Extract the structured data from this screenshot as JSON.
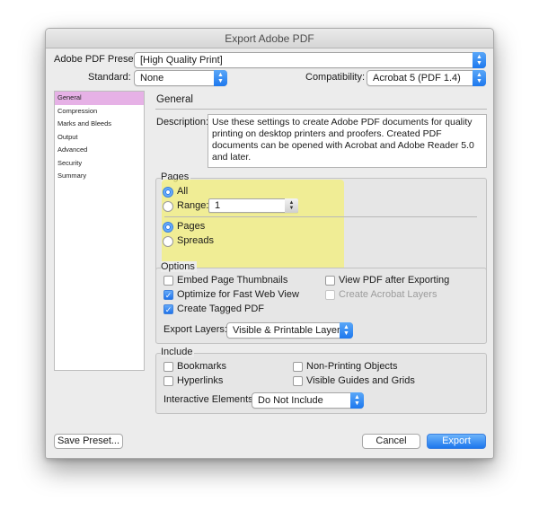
{
  "window": {
    "title": "Export Adobe PDF"
  },
  "preset": {
    "label": "Adobe PDF Preset:",
    "value": "[High Quality Print]"
  },
  "standard": {
    "label": "Standard:",
    "value": "None"
  },
  "compatibility": {
    "label": "Compatibility:",
    "value": "Acrobat 5 (PDF 1.4)"
  },
  "sidebar": {
    "items": [
      {
        "label": "General",
        "selected": true
      },
      {
        "label": "Compression"
      },
      {
        "label": "Marks and Bleeds"
      },
      {
        "label": "Output"
      },
      {
        "label": "Advanced"
      },
      {
        "label": "Security"
      },
      {
        "label": "Summary"
      }
    ]
  },
  "general": {
    "heading": "General",
    "description_label": "Description:",
    "description": "Use these settings to create Adobe PDF documents for quality printing on desktop printers and proofers.  Created PDF documents can be opened with Acrobat and Adobe Reader 5.0 and later."
  },
  "pages": {
    "title": "Pages",
    "all": "All",
    "range_label": "Range:",
    "range_value": "1",
    "pages_option": "Pages",
    "spreads_option": "Spreads"
  },
  "options": {
    "title": "Options",
    "embed_thumbnails": "Embed Page Thumbnails",
    "view_pdf": "View PDF after Exporting",
    "optimize_web": "Optimize for Fast Web View",
    "create_layers": "Create Acrobat Layers",
    "create_tagged": "Create Tagged PDF",
    "export_layers_label": "Export Layers:",
    "export_layers_value": "Visible & Printable Layers"
  },
  "include": {
    "title": "Include",
    "bookmarks": "Bookmarks",
    "non_printing": "Non-Printing Objects",
    "hyperlinks": "Hyperlinks",
    "visible_guides": "Visible Guides and Grids",
    "interactive_label": "Interactive Elements:",
    "interactive_value": "Do Not Include"
  },
  "buttons": {
    "save_preset": "Save Preset...",
    "cancel": "Cancel",
    "export": "Export"
  },
  "colors": {
    "highlight": "#f4f076",
    "accent": "#1d77ed",
    "sidebar_selected": "#e6b1e6"
  }
}
